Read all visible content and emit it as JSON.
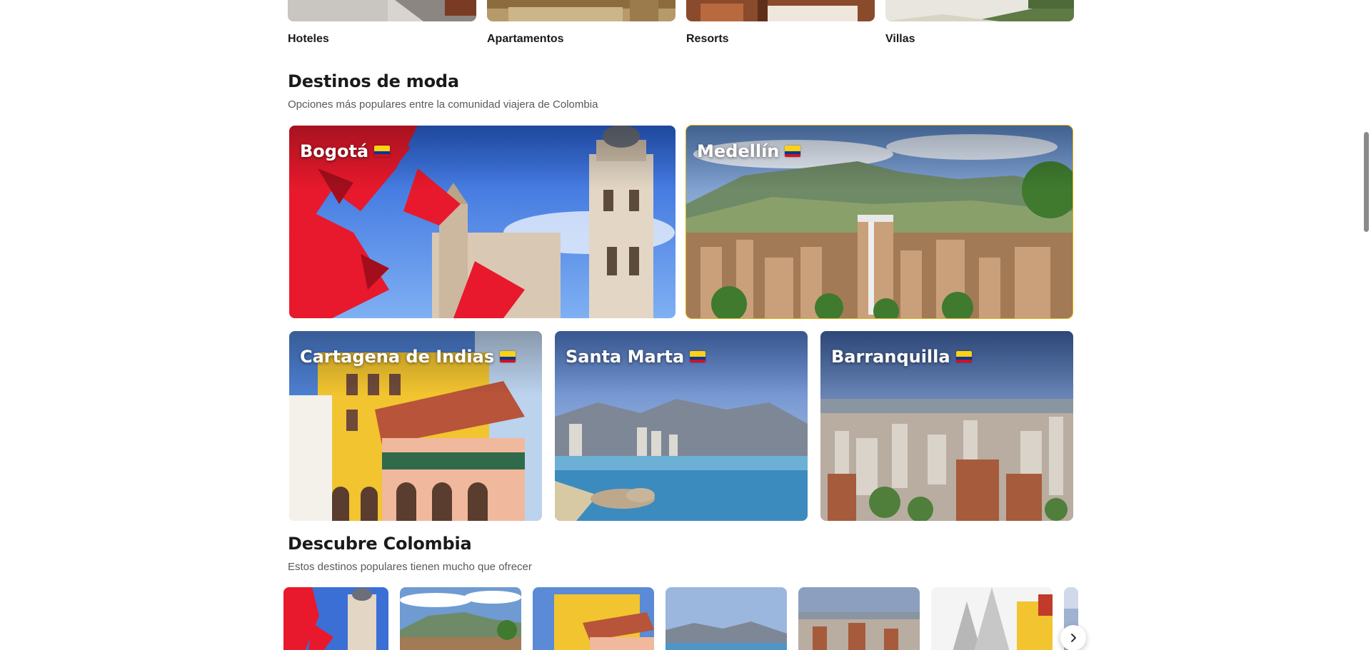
{
  "property_types": [
    {
      "label": "Hoteles"
    },
    {
      "label": "Apartamentos"
    },
    {
      "label": "Resorts"
    },
    {
      "label": "Villas"
    }
  ],
  "trending": {
    "title": "Destinos de moda",
    "subtitle": "Opciones más populares entre la comunidad viajera de Colombia",
    "destinations": [
      {
        "name": "Bogotá",
        "flag": "colombia-flag"
      },
      {
        "name": "Medellín",
        "flag": "colombia-flag"
      },
      {
        "name": "Cartagena de Indias",
        "flag": "colombia-flag"
      },
      {
        "name": "Santa Marta",
        "flag": "colombia-flag"
      },
      {
        "name": "Barranquilla",
        "flag": "colombia-flag"
      }
    ]
  },
  "discover": {
    "title": "Descubre Colombia",
    "subtitle": "Estos destinos populares tienen mucho que ofrecer"
  },
  "colors": {
    "flag_yellow": "#fcd116",
    "flag_blue": "#003893",
    "flag_red": "#ce1126",
    "active_outline": "#e2b007"
  },
  "icons": {
    "next": "chevron-right-icon"
  }
}
